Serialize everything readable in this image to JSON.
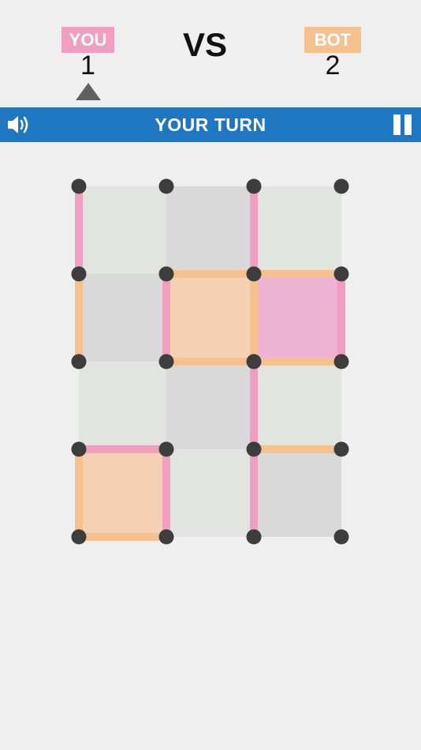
{
  "header": {
    "player_label": "YOU",
    "player_score": "1",
    "versus": "VS",
    "opponent_label": "BOT",
    "opponent_score": "2"
  },
  "status": {
    "turn_text": "YOUR TURN",
    "sound_icon": "speaker-icon",
    "pause_icon": "pause-icon"
  },
  "colors": {
    "player": "#f09fc0",
    "opponent": "#f7c18f",
    "player_box": "#eeb3d2",
    "opponent_box": "#f5d1b4",
    "cell_light": "#e1e4df",
    "cell_dark": "#d9d9d9",
    "dot": "#3d3d3d",
    "bar": "#1f77c1",
    "background": "#efefef"
  },
  "board": {
    "cols": 3,
    "rows": 4,
    "cells": [
      [
        "light",
        "dark",
        "light"
      ],
      [
        "dark",
        "opponent",
        "player"
      ],
      [
        "light",
        "dark",
        "light"
      ],
      [
        "opponent",
        "light",
        "dark"
      ]
    ],
    "h_lines": [
      [
        null,
        null,
        null
      ],
      [
        null,
        "opponent",
        "opponent"
      ],
      [
        null,
        "opponent",
        "opponent"
      ],
      [
        "player",
        null,
        "opponent"
      ],
      [
        "opponent",
        null,
        null
      ]
    ],
    "v_lines": [
      [
        "player",
        null,
        "player",
        null
      ],
      [
        "opponent",
        "player",
        "opponent",
        "player"
      ],
      [
        null,
        null,
        "player",
        null
      ],
      [
        "opponent",
        "player",
        "player",
        null
      ]
    ]
  }
}
